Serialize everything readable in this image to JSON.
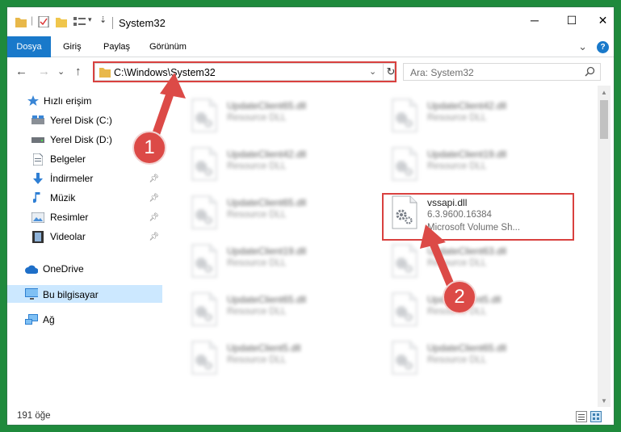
{
  "window": {
    "title": "System32",
    "minimize": "─",
    "maximize": "☐",
    "close": "✕"
  },
  "ribbon": {
    "tabs": [
      "Dosya",
      "Giriş",
      "Paylaş",
      "Görünüm"
    ],
    "expand_glyph": "⌄",
    "help": "?"
  },
  "address": {
    "path": "C:\\Windows\\System32",
    "dropdown": "⌄",
    "refresh": "↻"
  },
  "search": {
    "placeholder": "Ara: System32"
  },
  "nav": {
    "back": "←",
    "forward": "→",
    "recent": "⌄",
    "up": "↑",
    "items": [
      {
        "label": "Hızlı erişim",
        "icon": "star-icon"
      },
      {
        "label": "Yerel Disk (C:)",
        "icon": "drive-icon"
      },
      {
        "label": "Yerel Disk (D:)",
        "icon": "drive-icon"
      },
      {
        "label": "Belgeler",
        "icon": "document-icon"
      },
      {
        "label": "İndirmeler",
        "icon": "download-icon"
      },
      {
        "label": "Müzik",
        "icon": "music-icon"
      },
      {
        "label": "Resimler",
        "icon": "pictures-icon"
      },
      {
        "label": "Videolar",
        "icon": "video-icon"
      },
      {
        "label": "OneDrive",
        "icon": "cloud-icon"
      },
      {
        "label": "Bu bilgisayar",
        "icon": "computer-icon"
      },
      {
        "label": "Ağ",
        "icon": "network-icon"
      }
    ]
  },
  "files": {
    "left": [
      {
        "name": "UpdateClient65.dll",
        "type": "Resource DLL"
      },
      {
        "name": "UpdateClient42.dll",
        "type": "Resource DLL"
      },
      {
        "name": "UpdateClient65.dll",
        "type": "Resource DLL"
      },
      {
        "name": "UpdateClient19.dll",
        "type": "Resource DLL"
      },
      {
        "name": "UpdateClient65.dll",
        "type": "Resource DLL"
      },
      {
        "name": "UpdateClient5.dll",
        "type": "Resource DLL"
      }
    ],
    "right": [
      {
        "name": "UpdateClient42.dll",
        "type": "Resource DLL"
      },
      {
        "name": "UpdateClient19.dll",
        "type": "Resource DLL"
      },
      {
        "name": "UpdateClient63.dll",
        "type": "Resource DLL"
      },
      {
        "name": "UpdateClient5.dll",
        "type": "Resource DLL"
      },
      {
        "name": "UpdateClient65.dll",
        "type": "Resource DLL"
      }
    ],
    "target": {
      "name": "vssapi.dll",
      "version": "6.3.9600.16384",
      "description": "Microsoft Volume Sh..."
    }
  },
  "status": {
    "count": "191 öğe"
  },
  "annotations": {
    "step1": "1",
    "step2": "2",
    "color": "#dc4a47"
  }
}
